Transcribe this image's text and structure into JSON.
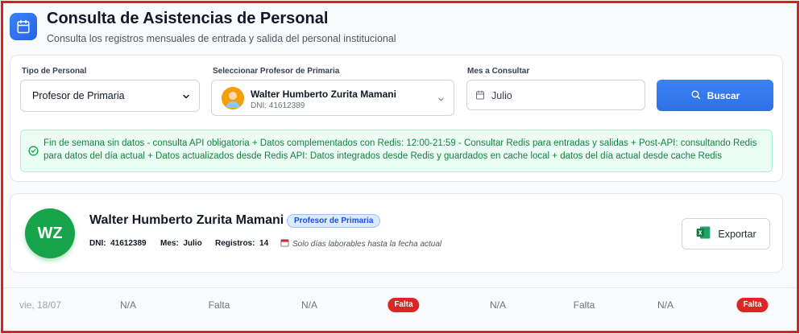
{
  "header": {
    "title": "Consulta de Asistencias de Personal",
    "subtitle": "Consulta los registros mensuales de entrada y salida del personal institucional",
    "icon": "calendar-icon"
  },
  "filters": {
    "tipo_label": "Tipo de Personal",
    "tipo_value": "Profesor de Primaria",
    "profesor_label": "Seleccionar Profesor de Primaria",
    "profesor_name": "Walter Humberto Zurita Mamani",
    "profesor_dni": "DNI: 41612389",
    "mes_label": "Mes a Consultar",
    "mes_value": "Julio",
    "buscar_label": "Buscar"
  },
  "info_message": "Fin de semana sin datos - consulta API obligatoria + Datos complementados con Redis: 12:00-21:59 - Consultar Redis para entradas y salidas + Post-API: consultando Redis para datos del día actual + Datos actualizados desde Redis API: Datos integrados desde Redis y guardados en cache local + datos del día actual desde cache Redis",
  "profile": {
    "initials": "WZ",
    "name": "Walter Humberto Zurita Mamani",
    "badge": "Profesor de Primaria",
    "dni_label": "DNI:",
    "dni_value": "41612389",
    "mes_label": "Mes:",
    "mes_value": "Julio",
    "registros_label": "Registros:",
    "registros_value": "14",
    "note": "Solo días laborables hasta la fecha actual",
    "export_label": "Exportar"
  },
  "row": {
    "date": "vie, 18/07",
    "cells": [
      "N/A",
      "Falta",
      "N/A",
      "Falta",
      "N/A",
      "Falta",
      "N/A",
      "Falta"
    ]
  },
  "colors": {
    "accent": "#3b82f6",
    "success": "#16a34a",
    "danger": "#dc2626",
    "frame": "#e11d24"
  }
}
